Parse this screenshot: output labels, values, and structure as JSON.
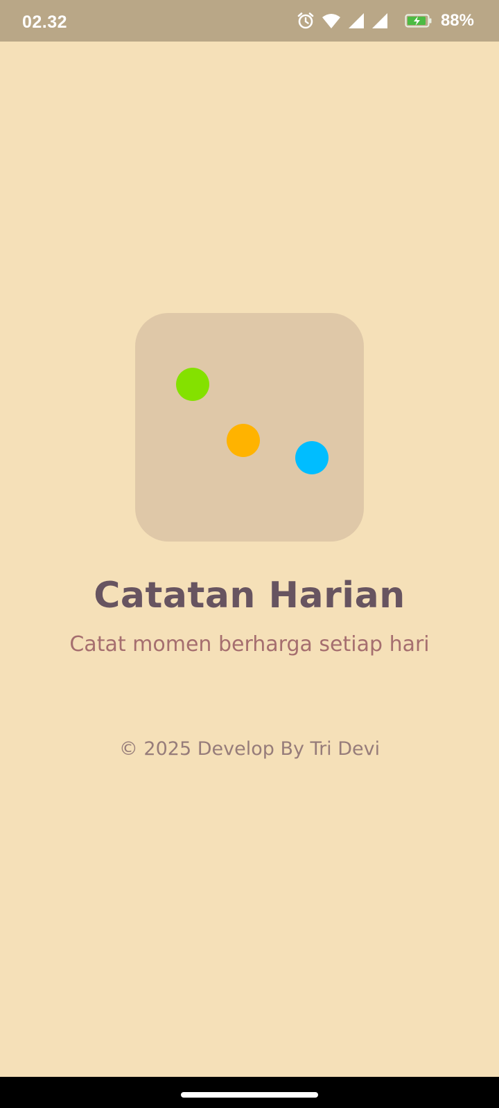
{
  "status_bar": {
    "time": "02.32",
    "battery_percent": "88%",
    "icons": [
      "alarm-icon",
      "wifi-icon",
      "cell-signal-icon",
      "cell-signal-icon",
      "battery-charging-icon"
    ]
  },
  "app_icon": {
    "background": "#dfc8a8",
    "dots": [
      {
        "name": "green-dot",
        "color": "#84e100"
      },
      {
        "name": "orange-dot",
        "color": "#ffb300"
      },
      {
        "name": "blue-dot",
        "color": "#00bdff"
      }
    ]
  },
  "splash": {
    "title": "Catatan Harian",
    "subtitle": "Catat momen berharga setiap hari",
    "copyright": "© 2025 Develop By Tri Devi"
  },
  "colors": {
    "background": "#f5e0b8",
    "status_bar": "#b9a787",
    "title": "#675460",
    "subtitle": "#a56e6f",
    "copyright": "#967c7a"
  }
}
